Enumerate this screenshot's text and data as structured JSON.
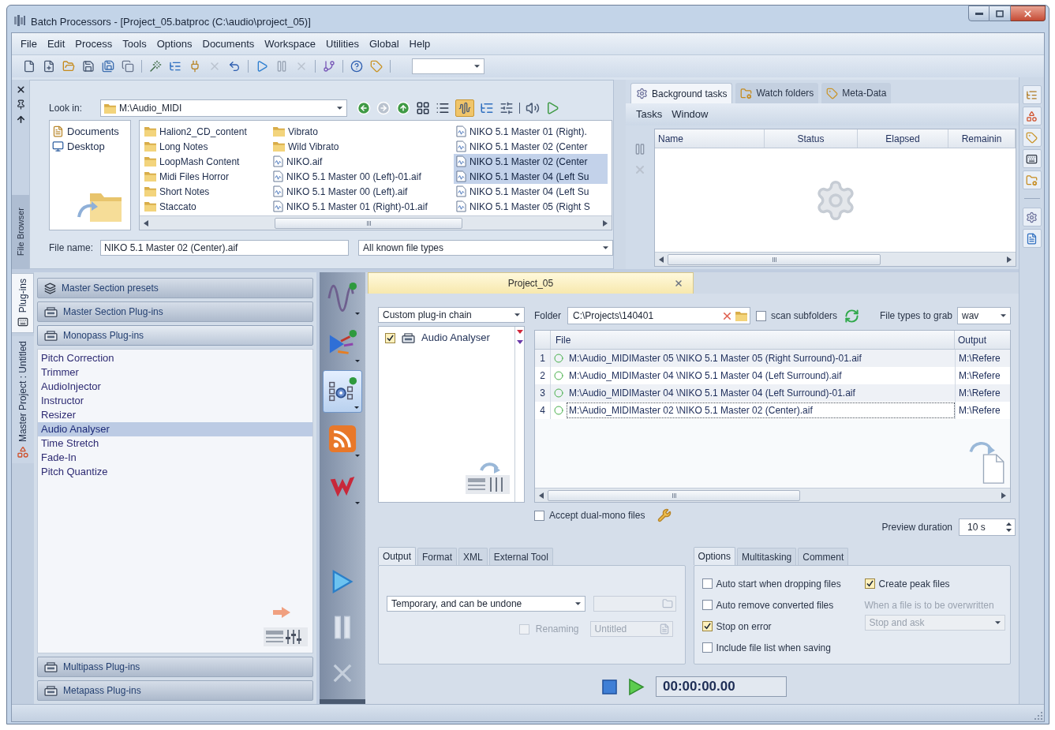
{
  "window": {
    "title": "Batch Processors - [Project_05.batproc (C:\\audio\\project_05)]"
  },
  "menu": [
    "File",
    "Edit",
    "Process",
    "Tools",
    "Options",
    "Documents",
    "Workspace",
    "Utilities",
    "Global",
    "Help"
  ],
  "file_browser": {
    "tab_label": "File Browser",
    "look_in": {
      "label": "Look in:",
      "value": "M:\\Audio_MIDI"
    },
    "places": [
      {
        "label": "Documents",
        "kind": "documents"
      },
      {
        "label": "Desktop",
        "kind": "desktop"
      }
    ],
    "files": [
      {
        "name": "Halion2_CD_content",
        "kind": "folder",
        "selected": false
      },
      {
        "name": "Long Notes",
        "kind": "folder",
        "selected": false
      },
      {
        "name": "LoopMash Content",
        "kind": "folder",
        "selected": false
      },
      {
        "name": "Midi Files Horror",
        "kind": "folder",
        "selected": false
      },
      {
        "name": "Short Notes",
        "kind": "folder",
        "selected": false
      },
      {
        "name": "Staccato",
        "kind": "folder",
        "selected": false
      },
      {
        "name": "Vibrato",
        "kind": "folder",
        "selected": false
      },
      {
        "name": "Wild Vibrato",
        "kind": "folder",
        "selected": false
      },
      {
        "name": "NIKO.aif",
        "kind": "audio",
        "selected": false
      },
      {
        "name": "NIKO 5.1 Master 00 (Left)-01.aif",
        "kind": "audio",
        "selected": false
      },
      {
        "name": "NIKO 5.1 Master 00 (Left).aif",
        "kind": "audio",
        "selected": false
      },
      {
        "name": "NIKO 5.1 Master 01 (Right)-01.aif",
        "kind": "audio",
        "selected": false
      },
      {
        "name": "NIKO 5.1 Master 01 (Right).",
        "kind": "audio",
        "selected": false
      },
      {
        "name": "NIKO 5.1 Master 02 (Center",
        "kind": "audio",
        "selected": false
      },
      {
        "name": "NIKO 5.1 Master 02 (Center",
        "kind": "audio",
        "selected": true
      },
      {
        "name": "NIKO 5.1 Master 04 (Left Su",
        "kind": "audio",
        "selected": true
      },
      {
        "name": "NIKO 5.1 Master 04 (Left Su",
        "kind": "audio",
        "selected": false
      },
      {
        "name": "NIKO 5.1 Master 05 (Right S",
        "kind": "audio",
        "selected": false
      }
    ],
    "file_name": {
      "label": "File name:",
      "value": "NIKO 5.1 Master 02 (Center).aif"
    },
    "file_type": "All known file types"
  },
  "background": {
    "tabs": [
      {
        "label": "Background tasks",
        "selected": true
      },
      {
        "label": "Watch folders",
        "selected": false
      },
      {
        "label": "Meta-Data",
        "selected": false
      }
    ],
    "menu": [
      "Tasks",
      "Window"
    ],
    "columns": [
      "Name",
      "Status",
      "Elapsed",
      "Remainin"
    ]
  },
  "side_tabs": [
    {
      "label": "Plug-ins",
      "kind": "plugins",
      "selected": true
    },
    {
      "label": "Master Project : Untitled",
      "kind": "project",
      "selected": false
    }
  ],
  "plugin_sections": [
    {
      "label": "Master Section presets",
      "expanded": false
    },
    {
      "label": "Master Section Plug-ins",
      "expanded": false
    },
    {
      "label": "Monopass Plug-ins",
      "expanded": true,
      "items": [
        {
          "label": "Pitch Correction",
          "selected": false
        },
        {
          "label": "Trimmer",
          "selected": false
        },
        {
          "label": "AudioInjector",
          "selected": false
        },
        {
          "label": "Instructor",
          "selected": false
        },
        {
          "label": "Resizer",
          "selected": false
        },
        {
          "label": "Audio Analyser",
          "selected": true
        },
        {
          "label": "Time Stretch",
          "selected": false
        },
        {
          "label": "Fade-In",
          "selected": false
        },
        {
          "label": "Pitch Quantize",
          "selected": false
        }
      ]
    },
    {
      "label": "Multipass Plug-ins",
      "expanded": false
    },
    {
      "label": "Metapass Plug-ins",
      "expanded": false
    }
  ],
  "tool_strip": [
    {
      "kind": "waveform",
      "selected": false
    },
    {
      "kind": "routing",
      "selected": false
    },
    {
      "kind": "chain",
      "selected": true
    },
    {
      "kind": "feed",
      "selected": false
    },
    {
      "kind": "logo",
      "selected": false
    }
  ],
  "actions": [
    {
      "kind": "play",
      "disabled": false
    },
    {
      "kind": "pause",
      "disabled": true
    },
    {
      "kind": "cancel",
      "disabled": true
    }
  ],
  "project": {
    "tab_title": "Project_05",
    "chain_preset": "Custom plug-in chain",
    "chain": [
      {
        "name": "Audio Analyser",
        "checked": true
      }
    ],
    "folder": {
      "label": "Folder",
      "value": "C:\\Projects\\140401"
    },
    "scan_subfolders": {
      "label": "scan subfolders",
      "checked": false
    },
    "file_types": {
      "label": "File types to grab",
      "value": "wav"
    },
    "columns": [
      "File",
      "Output"
    ],
    "rows": [
      {
        "index": "1",
        "file": "M:\\Audio_MIDIMaster 05 \\NIKO 5.1 Master 05 (Right Surround)-01.aif",
        "output": "M:\\Refere",
        "focused": false
      },
      {
        "index": "2",
        "file": "M:\\Audio_MIDIMaster 04 \\NIKO 5.1 Master 04 (Left Surround).aif",
        "output": "M:\\Refere",
        "focused": false
      },
      {
        "index": "3",
        "file": "M:\\Audio_MIDIMaster 04 \\NIKO 5.1 Master 04 (Left Surround)-01.aif",
        "output": "M:\\Refere",
        "focused": false
      },
      {
        "index": "4",
        "file": "M:\\Audio_MIDIMaster 02 \\NIKO 5.1 Master 02 (Center).aif",
        "output": "M:\\Refere",
        "focused": true
      }
    ],
    "accept_dual_mono": {
      "label": "Accept dual-mono files",
      "checked": false
    },
    "preview": {
      "label": "Preview duration",
      "value": "10 s"
    },
    "output_tabs": [
      {
        "label": "Output",
        "selected": true
      },
      {
        "label": "Format",
        "selected": false
      },
      {
        "label": "XML",
        "selected": false
      },
      {
        "label": "External Tool",
        "selected": false
      }
    ],
    "output_mode": "Temporary, and can be undone",
    "output_path": {
      "disabled": true
    },
    "renaming": {
      "label": "Renaming",
      "checked": false,
      "disabled": true,
      "value": "Untitled"
    },
    "options_tabs": [
      {
        "label": "Options",
        "selected": true
      },
      {
        "label": "Multitasking",
        "selected": false
      },
      {
        "label": "Comment",
        "selected": false
      }
    ],
    "options": [
      {
        "label": "Auto start when dropping files",
        "checked": false
      },
      {
        "label": "Auto remove converted files",
        "checked": false
      },
      {
        "label": "Stop on error",
        "checked": true
      },
      {
        "label": "Include file list when saving",
        "checked": false
      }
    ],
    "create_peak_files": {
      "label": "Create peak files",
      "checked": true
    },
    "overwrite": {
      "label": "When a file is to be overwritten",
      "value": "Stop and ask",
      "disabled": true
    },
    "time": "00:00:00.00"
  }
}
